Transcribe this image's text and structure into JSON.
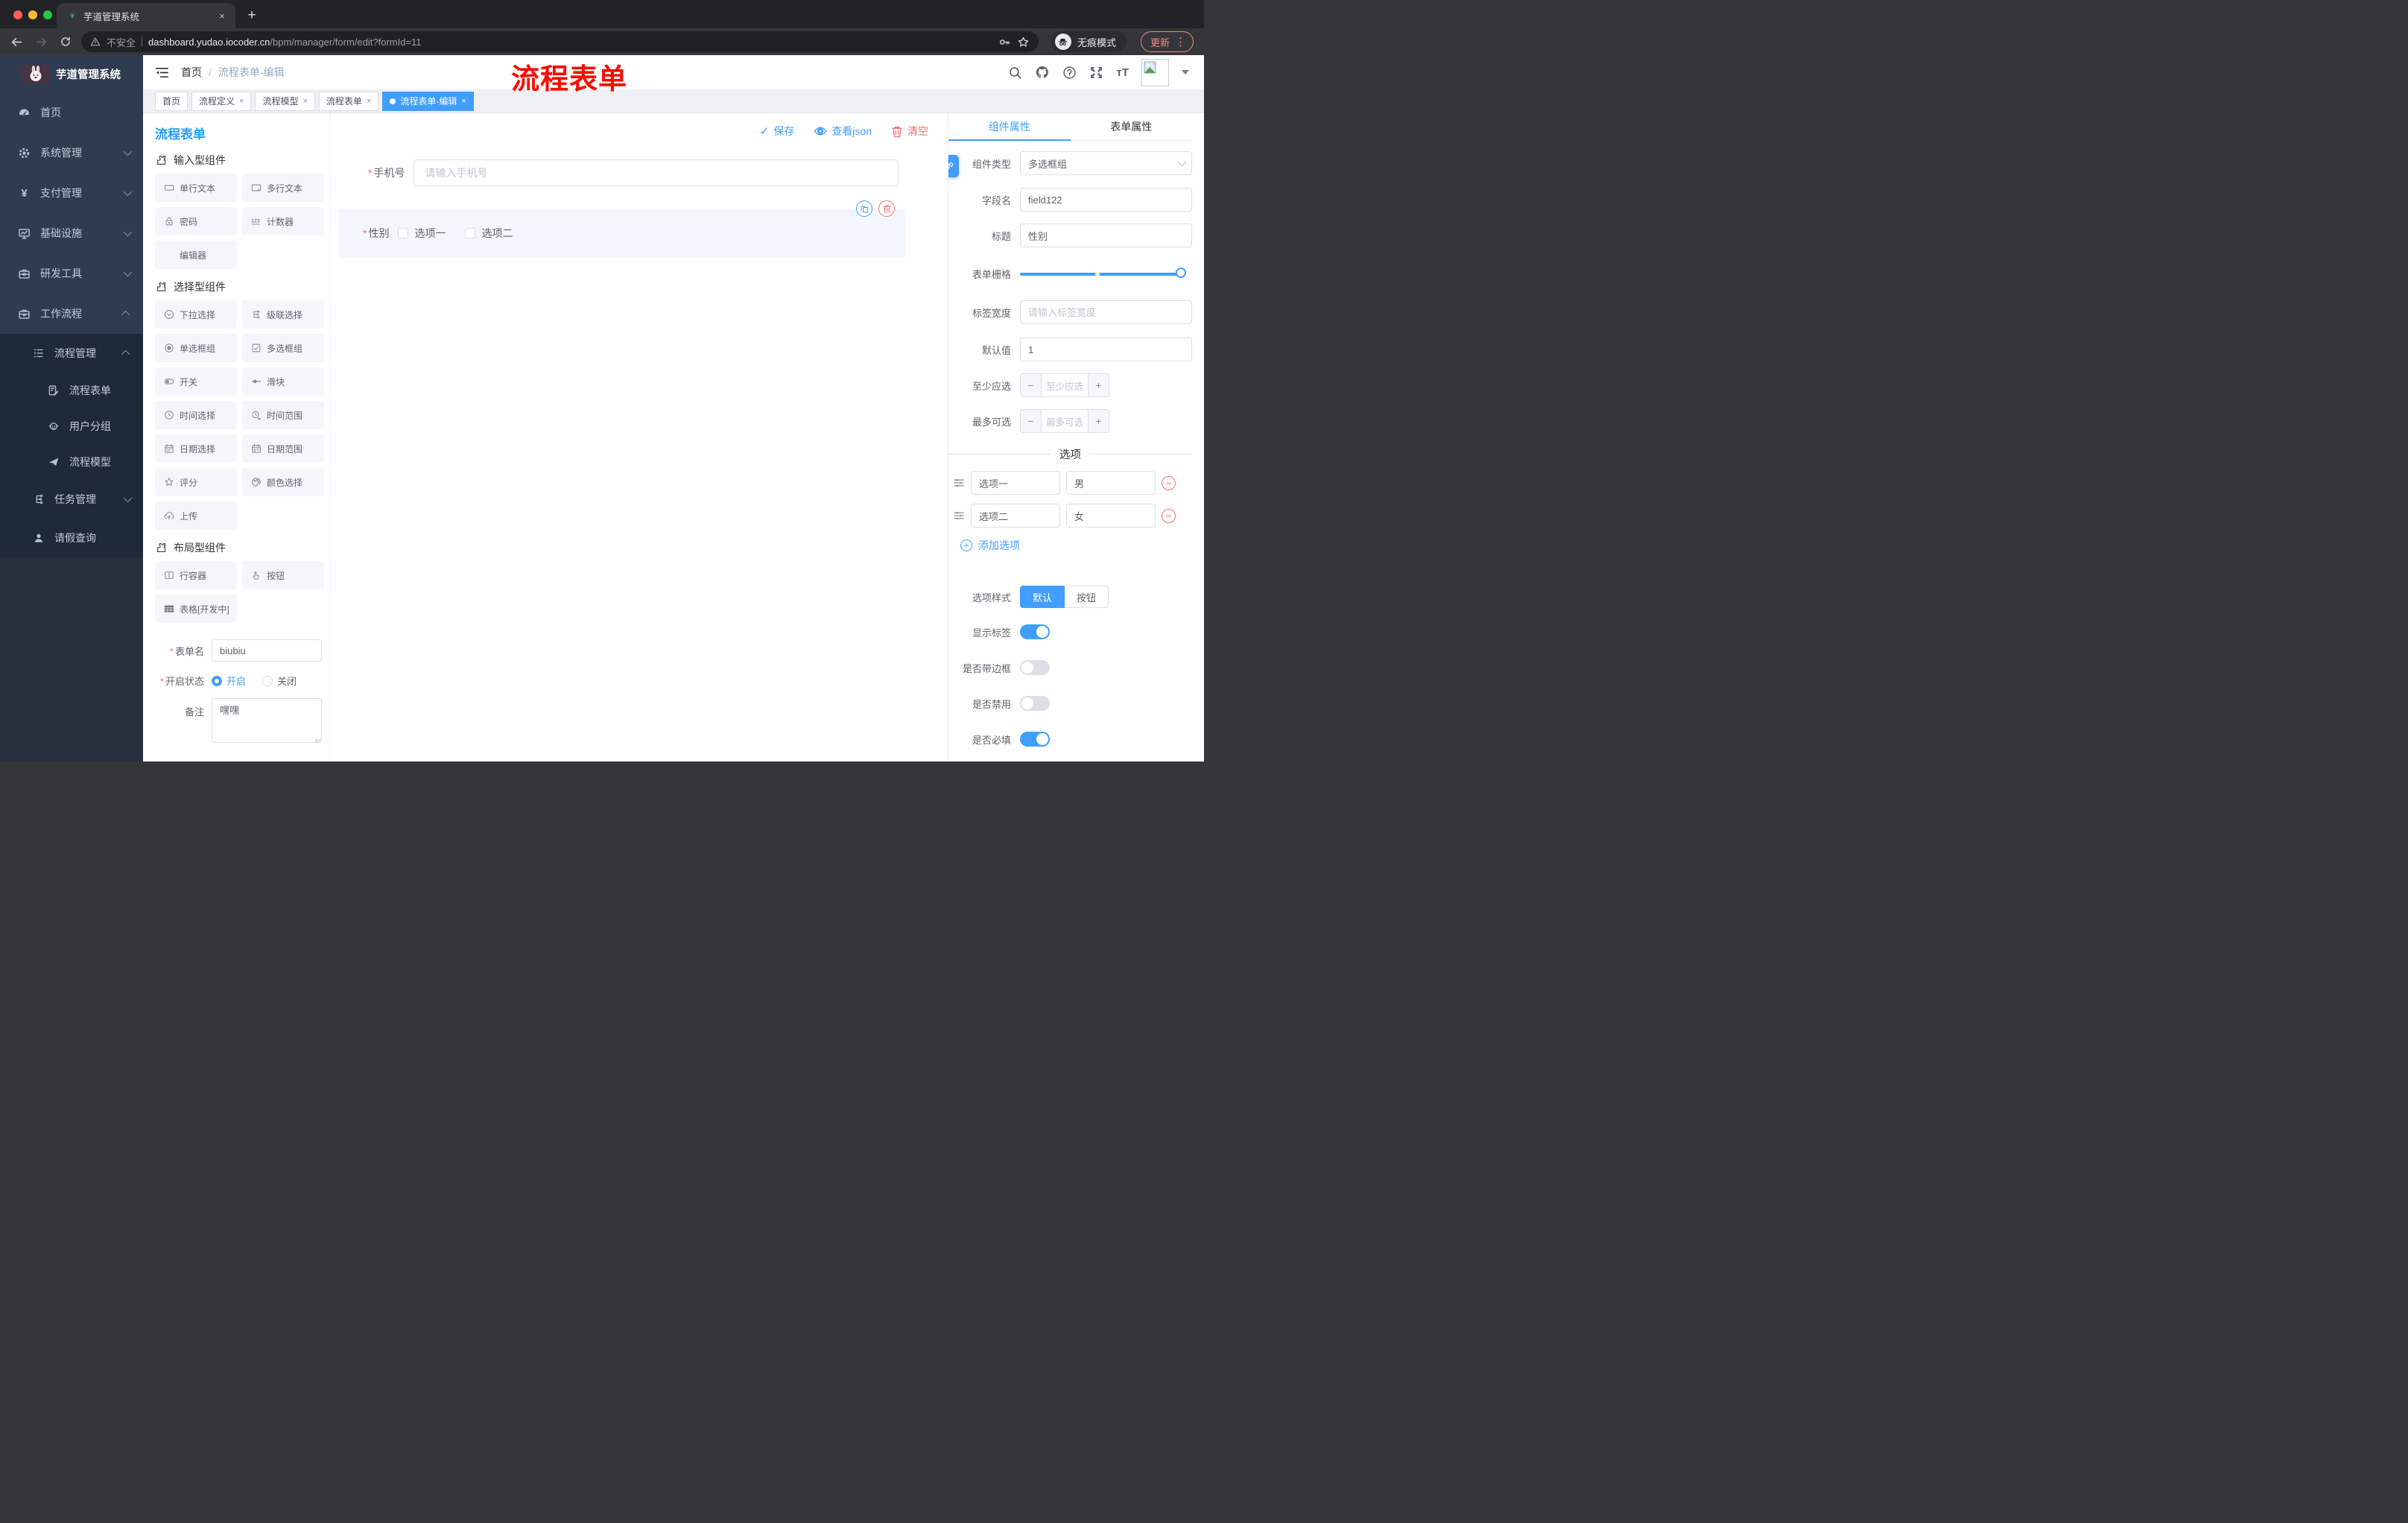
{
  "colors": {
    "accent": "#409eff",
    "danger": "#f56c6c",
    "annotation": "#fb0b00",
    "sidebar_top": "#2f3c50",
    "sidebar_dark": "#1f2a39",
    "chrome": "#35363a",
    "update": "#f28b82"
  },
  "ui": {
    "close": "×",
    "plus": "+",
    "minus": "−",
    "slash": "/",
    "caret_glyph": "⋮",
    "check": "✓",
    "asterisk": "*",
    "new_tab": "+",
    "question": "?"
  },
  "browser": {
    "tab_title": "芋道管理系统",
    "security_label": "不安全",
    "url_domain": "dashboard.yudao.iocoder.cn",
    "url_path": "/bpm/manager/form/edit?formId=11",
    "incognito_label": "无痕模式",
    "update_label": "更新"
  },
  "sidebar": {
    "logo_title": "芋道管理系统",
    "items": [
      {
        "label": "首页",
        "icon": "dashboard-icon"
      },
      {
        "label": "系统管理",
        "icon": "gear-icon"
      },
      {
        "label": "支付管理",
        "icon": "yen-icon"
      },
      {
        "label": "基础设施",
        "icon": "monitor-icon"
      },
      {
        "label": "研发工具",
        "icon": "toolbox-icon"
      },
      {
        "label": "工作流程",
        "icon": "briefcase-icon"
      },
      {
        "label": "流程管理",
        "icon": "process-list-icon"
      },
      {
        "label": "流程表单",
        "icon": "form-doc-icon"
      },
      {
        "label": "用户分组",
        "icon": "user-group-icon"
      },
      {
        "label": "流程模型",
        "icon": "paper-plane-icon"
      },
      {
        "label": "任务管理",
        "icon": "task-tree-icon"
      },
      {
        "label": "请假查询",
        "icon": "person-icon"
      }
    ]
  },
  "header": {
    "breadcrumb": [
      "首页",
      "流程表单-编辑"
    ],
    "annotation": "流程表单"
  },
  "tags": [
    {
      "label": "首页",
      "closable": false,
      "active": false
    },
    {
      "label": "流程定义",
      "closable": true,
      "active": false
    },
    {
      "label": "流程模型",
      "closable": true,
      "active": false
    },
    {
      "label": "流程表单",
      "closable": true,
      "active": false
    },
    {
      "label": "流程表单-编辑",
      "closable": true,
      "active": true
    }
  ],
  "designer": {
    "title": "流程表单",
    "actions": {
      "save": "保存",
      "view_json": "查看json",
      "clear": "清空"
    }
  },
  "left_panel": {
    "sections": [
      {
        "title": "输入型组件",
        "items": [
          {
            "label": "单行文本",
            "icon": "single-line-icon"
          },
          {
            "label": "多行文本",
            "icon": "multi-line-icon"
          },
          {
            "label": "密码",
            "icon": "lock-icon"
          },
          {
            "label": "计数器",
            "icon": "counter-icon"
          },
          {
            "label": "编辑器",
            "icon": "none"
          }
        ]
      },
      {
        "title": "选择型组件",
        "items": [
          {
            "label": "下拉选择",
            "icon": "select-icon"
          },
          {
            "label": "级联选择",
            "icon": "cascade-icon"
          },
          {
            "label": "单选框组",
            "icon": "radio-icon"
          },
          {
            "label": "多选框组",
            "icon": "checkbox-icon"
          },
          {
            "label": "开关",
            "icon": "switch-icon"
          },
          {
            "label": "滑块",
            "icon": "slider-icon"
          },
          {
            "label": "时间选择",
            "icon": "clock-icon"
          },
          {
            "label": "时间范围",
            "icon": "time-range-icon"
          },
          {
            "label": "日期选择",
            "icon": "calendar-icon"
          },
          {
            "label": "日期范围",
            "icon": "calendar-range-icon"
          },
          {
            "label": "评分",
            "icon": "star-icon"
          },
          {
            "label": "颜色选择",
            "icon": "palette-icon"
          },
          {
            "label": "上传",
            "icon": "upload-icon"
          }
        ]
      },
      {
        "title": "布局型组件",
        "items": [
          {
            "label": "行容器",
            "icon": "row-container-icon"
          },
          {
            "label": "按钮",
            "icon": "pointer-icon"
          },
          {
            "label": "表格[开发中]",
            "icon": "table-icon"
          }
        ]
      }
    ],
    "meta": {
      "name_label": "表单名",
      "name_value": "biubiu",
      "status_label": "开启状态",
      "status_options": [
        "开启",
        "关闭"
      ],
      "status_selected": "开启",
      "remark_label": "备注",
      "remark_value": "嘿嘿"
    }
  },
  "canvas": {
    "phone_label": "手机号",
    "phone_placeholder": "请输入手机号",
    "gender_label": "性别",
    "gender_options": [
      "选项一",
      "选项二"
    ]
  },
  "props": {
    "tabs": [
      "组件属性",
      "表单属性"
    ],
    "active_tab": "组件属性",
    "fields": {
      "type_label": "组件类型",
      "type_value": "多选框组",
      "field_label": "字段名",
      "field_value": "field122",
      "title_label": "标题",
      "title_value": "性别",
      "grid_label": "表单栅格",
      "grid_dot_position": "47%",
      "label_width_label": "标签宽度",
      "label_width_placeholder": "请输入标签宽度",
      "default_label": "默认值",
      "default_value": "1",
      "min_label": "至少应选",
      "min_placeholder": "至少应选",
      "max_label": "最多可选",
      "max_placeholder": "最多可选"
    },
    "options_title": "选项",
    "options": [
      {
        "label": "选项一",
        "value": "男"
      },
      {
        "label": "选项二",
        "value": "女"
      }
    ],
    "add_option_label": "添加选项",
    "style_label": "选项样式",
    "style_options": [
      "默认",
      "按钮"
    ],
    "style_selected": "默认",
    "toggles": [
      {
        "label": "显示标签",
        "on": true
      },
      {
        "label": "是否带边框",
        "on": false
      },
      {
        "label": "是否禁用",
        "on": false
      },
      {
        "label": "是否必填",
        "on": true
      }
    ]
  }
}
